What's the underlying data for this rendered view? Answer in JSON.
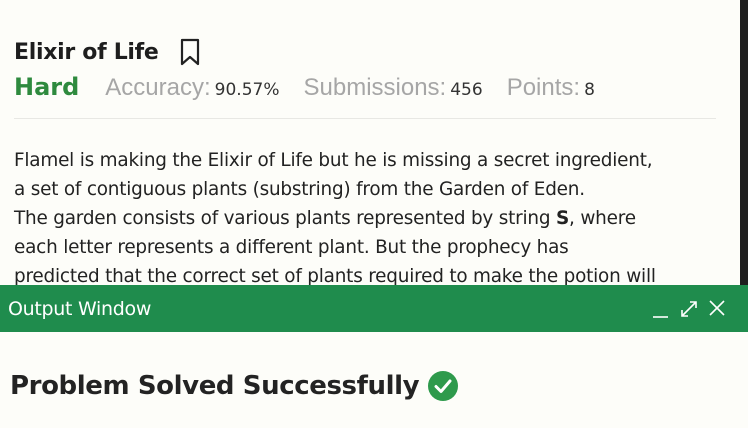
{
  "problem": {
    "title": "Elixir of Life",
    "difficulty": "Hard",
    "stats": [
      {
        "label": "Accuracy:",
        "value": "90.57%"
      },
      {
        "label": "Submissions:",
        "value": "456"
      },
      {
        "label": "Points:",
        "value": "8"
      }
    ],
    "description": {
      "line1": "Flamel is making the Elixir of Life but he is missing a secret ingredient,",
      "line2": "a set of contiguous plants (substring) from the Garden of Eden.",
      "line3_pre": "The garden consists of various plants represented by string ",
      "line3_bold": "S",
      "line3_post": ", where",
      "line4": "each letter represents a different plant.  But the prophecy has",
      "line5": "predicted that the correct set of plants required to make the potion will"
    }
  },
  "output_window": {
    "title": "Output Window",
    "result": "Problem Solved Successfully"
  },
  "icons": {
    "bookmark": "bookmark-icon",
    "minimize": "minimize-icon",
    "expand": "expand-icon",
    "close": "close-icon",
    "check": "check-circle-icon"
  },
  "colors": {
    "accent_green": "#1f8c4d",
    "difficulty_green": "#2e8a3e",
    "check_green": "#2e9a4c"
  }
}
